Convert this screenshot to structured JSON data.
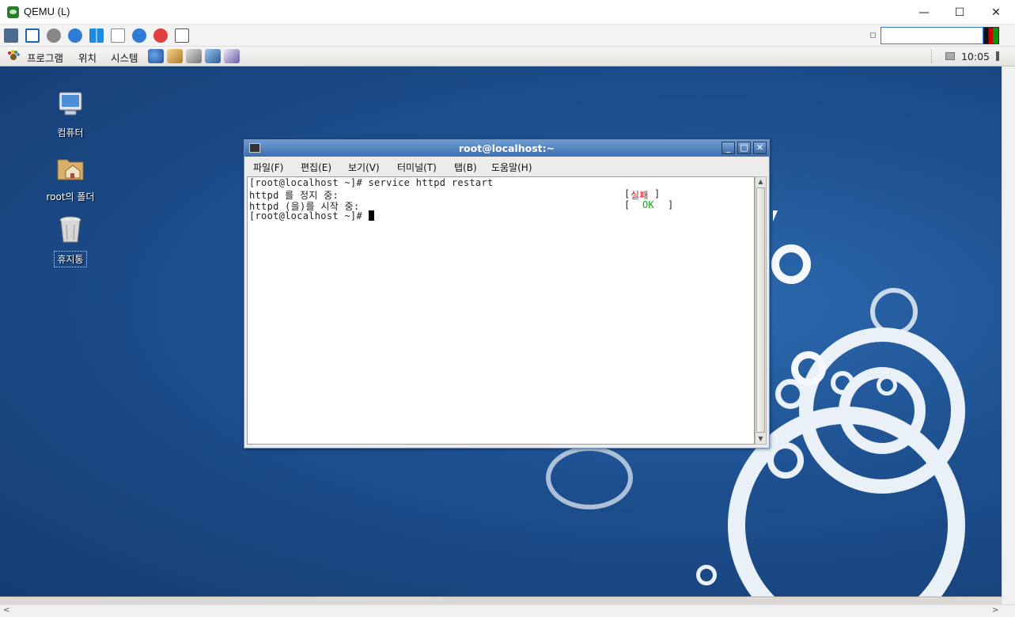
{
  "window": {
    "title": "QEMU (L)",
    "min_glyph": "—",
    "max_glyph": "☐",
    "close_glyph": "✕"
  },
  "qemu_toolbar": {
    "icons": [
      "settings-cubes-icon",
      "fullscreen-icon",
      "gear-icon",
      "refresh-icon",
      "windows-icon",
      "document-icon",
      "info-icon",
      "stop-icon",
      "screenshot-icon"
    ],
    "search_value": ""
  },
  "panel": {
    "menus": [
      "프로그램",
      "위치",
      "시스템"
    ],
    "clock": "10:05"
  },
  "desktop": {
    "icons": [
      {
        "label": "컴퓨터"
      },
      {
        "label": "root의 폴더"
      },
      {
        "label": "휴지통"
      }
    ]
  },
  "terminal": {
    "title": "root@localhost:~",
    "menu": [
      "파일(F)",
      "편집(E)",
      "보기(V)",
      "터미널(T)",
      "탭(B)",
      "도움말(H)"
    ],
    "lines": {
      "l1": "[root@localhost ~]# service httpd restart",
      "l2": "httpd 를 정지 중:",
      "l2_status_open": "[",
      "l2_status": "실패",
      "l2_status_close": "]",
      "l3": "httpd (을)를 시작 중:",
      "l3_status_open": "[",
      "l3_status": "OK",
      "l3_status_close": "]",
      "l4": "[root@localhost ~]# "
    }
  },
  "colors": {
    "fail": "#d11111",
    "ok": "#11aa11",
    "titlebar": "#3d6fb0",
    "desktop": "#1d4f8e"
  }
}
